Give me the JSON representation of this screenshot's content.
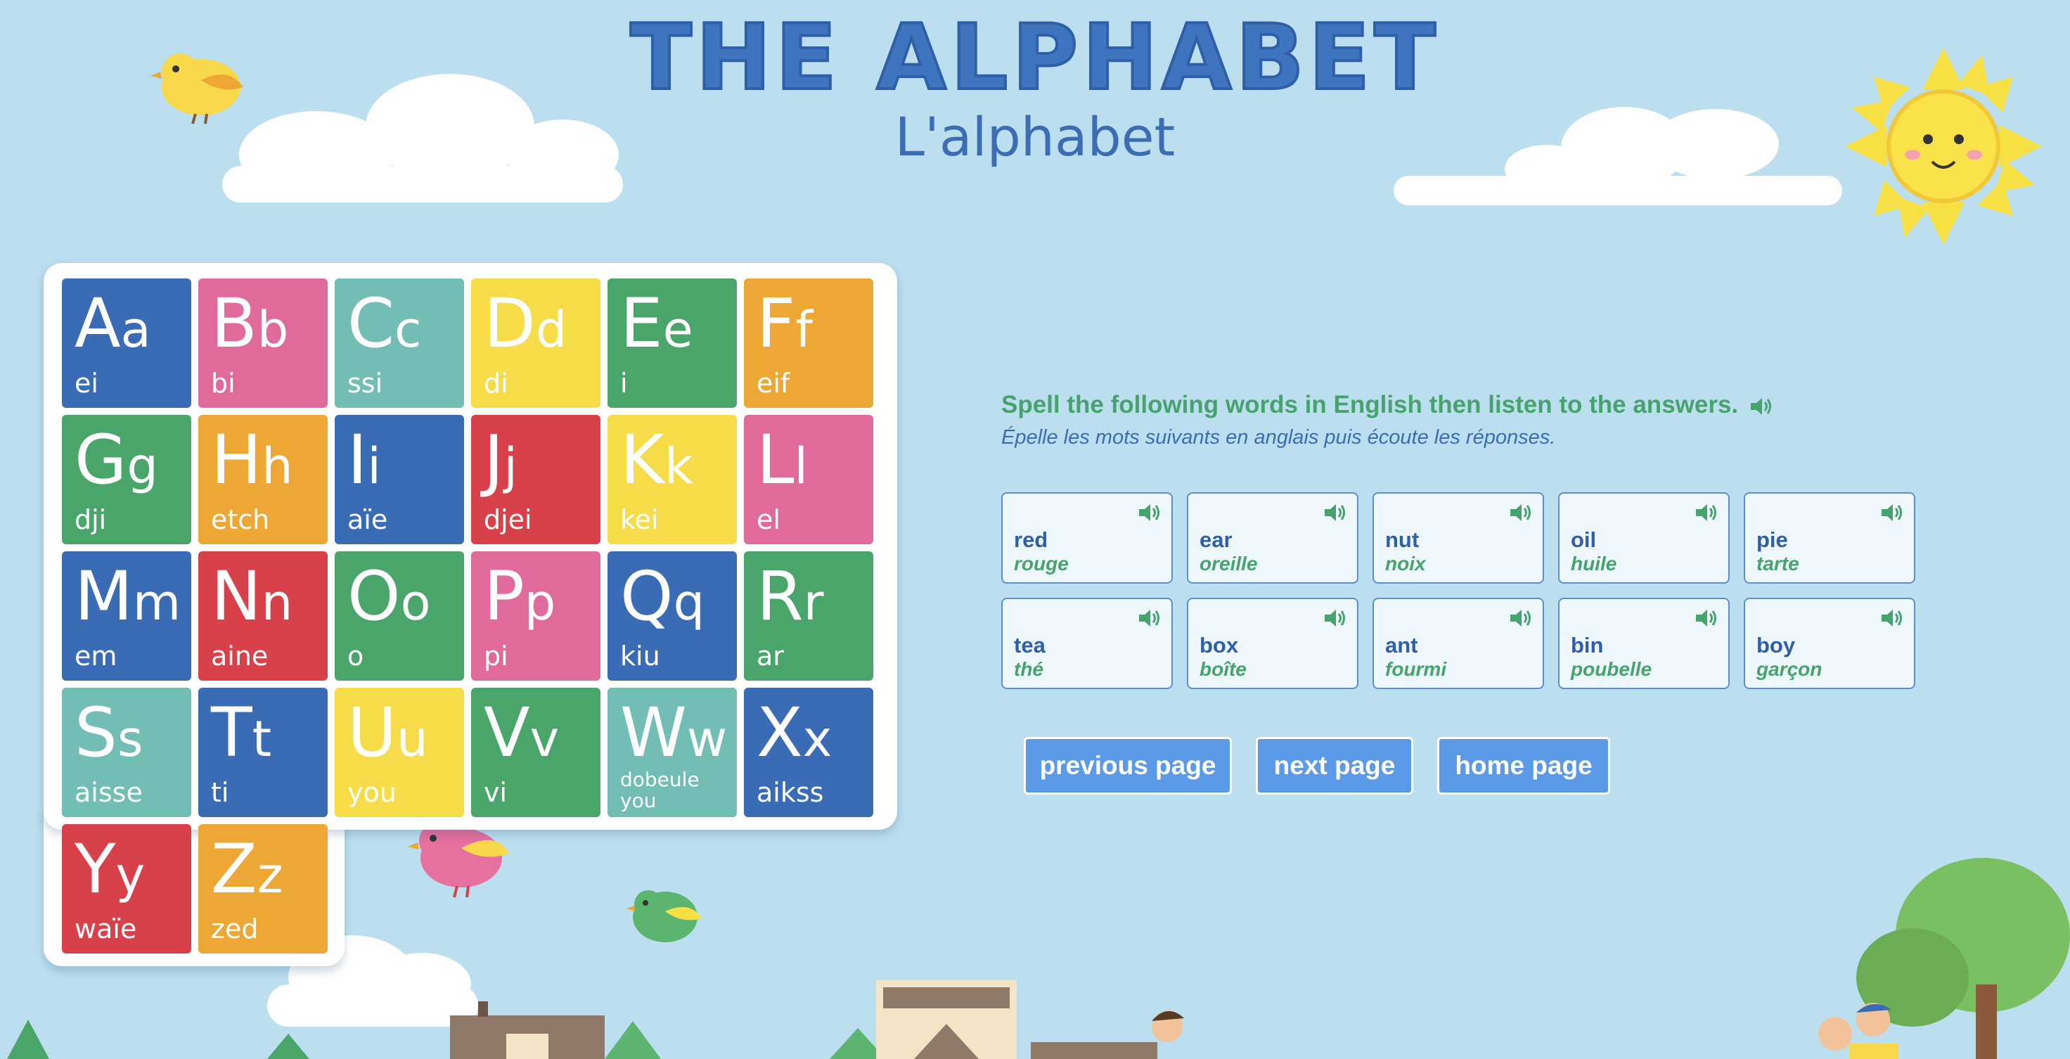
{
  "page": {
    "title": "THE ALPHABET",
    "subtitle": "L'alphabet"
  },
  "alphabet": [
    {
      "upper": "A",
      "lower": "a",
      "pron": "ei",
      "color": "#3a6cb5"
    },
    {
      "upper": "B",
      "lower": "b",
      "pron": "bi",
      "color": "#e06a9c"
    },
    {
      "upper": "C",
      "lower": "c",
      "pron": "ssi",
      "color": "#72bdb4"
    },
    {
      "upper": "D",
      "lower": "d",
      "pron": "di",
      "color": "#f7dc4a"
    },
    {
      "upper": "E",
      "lower": "e",
      "pron": "i",
      "color": "#4aa56a"
    },
    {
      "upper": "F",
      "lower": "f",
      "pron": "eif",
      "color": "#eca734"
    },
    {
      "upper": "G",
      "lower": "g",
      "pron": "dji",
      "color": "#4aa56a"
    },
    {
      "upper": "H",
      "lower": "h",
      "pron": "etch",
      "color": "#eca734"
    },
    {
      "upper": "I",
      "lower": "i",
      "pron": "aïe",
      "color": "#3a6cb5"
    },
    {
      "upper": "J",
      "lower": "j",
      "pron": "djei",
      "color": "#d8404a"
    },
    {
      "upper": "K",
      "lower": "k",
      "pron": "kei",
      "color": "#f7dc4a"
    },
    {
      "upper": "L",
      "lower": "l",
      "pron": "el",
      "color": "#e06a9c"
    },
    {
      "upper": "M",
      "lower": "m",
      "pron": "em",
      "color": "#3a6cb5"
    },
    {
      "upper": "N",
      "lower": "n",
      "pron": "aine",
      "color": "#d8404a"
    },
    {
      "upper": "O",
      "lower": "o",
      "pron": "o",
      "color": "#4aa56a"
    },
    {
      "upper": "P",
      "lower": "p",
      "pron": "pi",
      "color": "#e06a9c"
    },
    {
      "upper": "Q",
      "lower": "q",
      "pron": "kiu",
      "color": "#3a6cb5"
    },
    {
      "upper": "R",
      "lower": "r",
      "pron": "ar",
      "color": "#4aa56a"
    },
    {
      "upper": "S",
      "lower": "s",
      "pron": "aisse",
      "color": "#72bdb4"
    },
    {
      "upper": "T",
      "lower": "t",
      "pron": "ti",
      "color": "#3a6cb5"
    },
    {
      "upper": "U",
      "lower": "u",
      "pron": "you",
      "color": "#f7dc4a"
    },
    {
      "upper": "V",
      "lower": "v",
      "pron": "vi",
      "color": "#4aa56a"
    },
    {
      "upper": "W",
      "lower": "w",
      "pron": "dobeule you",
      "color": "#72bdb4"
    },
    {
      "upper": "X",
      "lower": "x",
      "pron": "aikss",
      "color": "#3a6cb5"
    },
    {
      "upper": "Y",
      "lower": "y",
      "pron": "waïe",
      "color": "#d8404a"
    },
    {
      "upper": "Z",
      "lower": "z",
      "pron": "zed",
      "color": "#eca734"
    }
  ],
  "exercise": {
    "instruction": "Spell the following words in English then listen to the answers.",
    "instruction_fr": "Épelle les mots suivants en anglais puis écoute les réponses.",
    "words": [
      {
        "en": "red",
        "fr": "rouge"
      },
      {
        "en": "ear",
        "fr": "oreille"
      },
      {
        "en": "nut",
        "fr": "noix"
      },
      {
        "en": "oil",
        "fr": "huile"
      },
      {
        "en": "pie",
        "fr": "tarte"
      },
      {
        "en": "tea",
        "fr": "thé"
      },
      {
        "en": "box",
        "fr": "boîte"
      },
      {
        "en": "ant",
        "fr": "fourmi"
      },
      {
        "en": "bin",
        "fr": "poubelle"
      },
      {
        "en": "boy",
        "fr": "garçon"
      }
    ]
  },
  "nav": {
    "previous": "previous page",
    "next": "next page",
    "home": "home page"
  },
  "icons": {
    "speaker": "speaker-icon",
    "sun": "sun-icon",
    "cloud": "cloud-icon",
    "bird": "bird-icon"
  },
  "colors": {
    "background": "#bcdff0",
    "title": "#3f74bf",
    "instruction": "#47a36d",
    "button": "#5b9ae6"
  }
}
